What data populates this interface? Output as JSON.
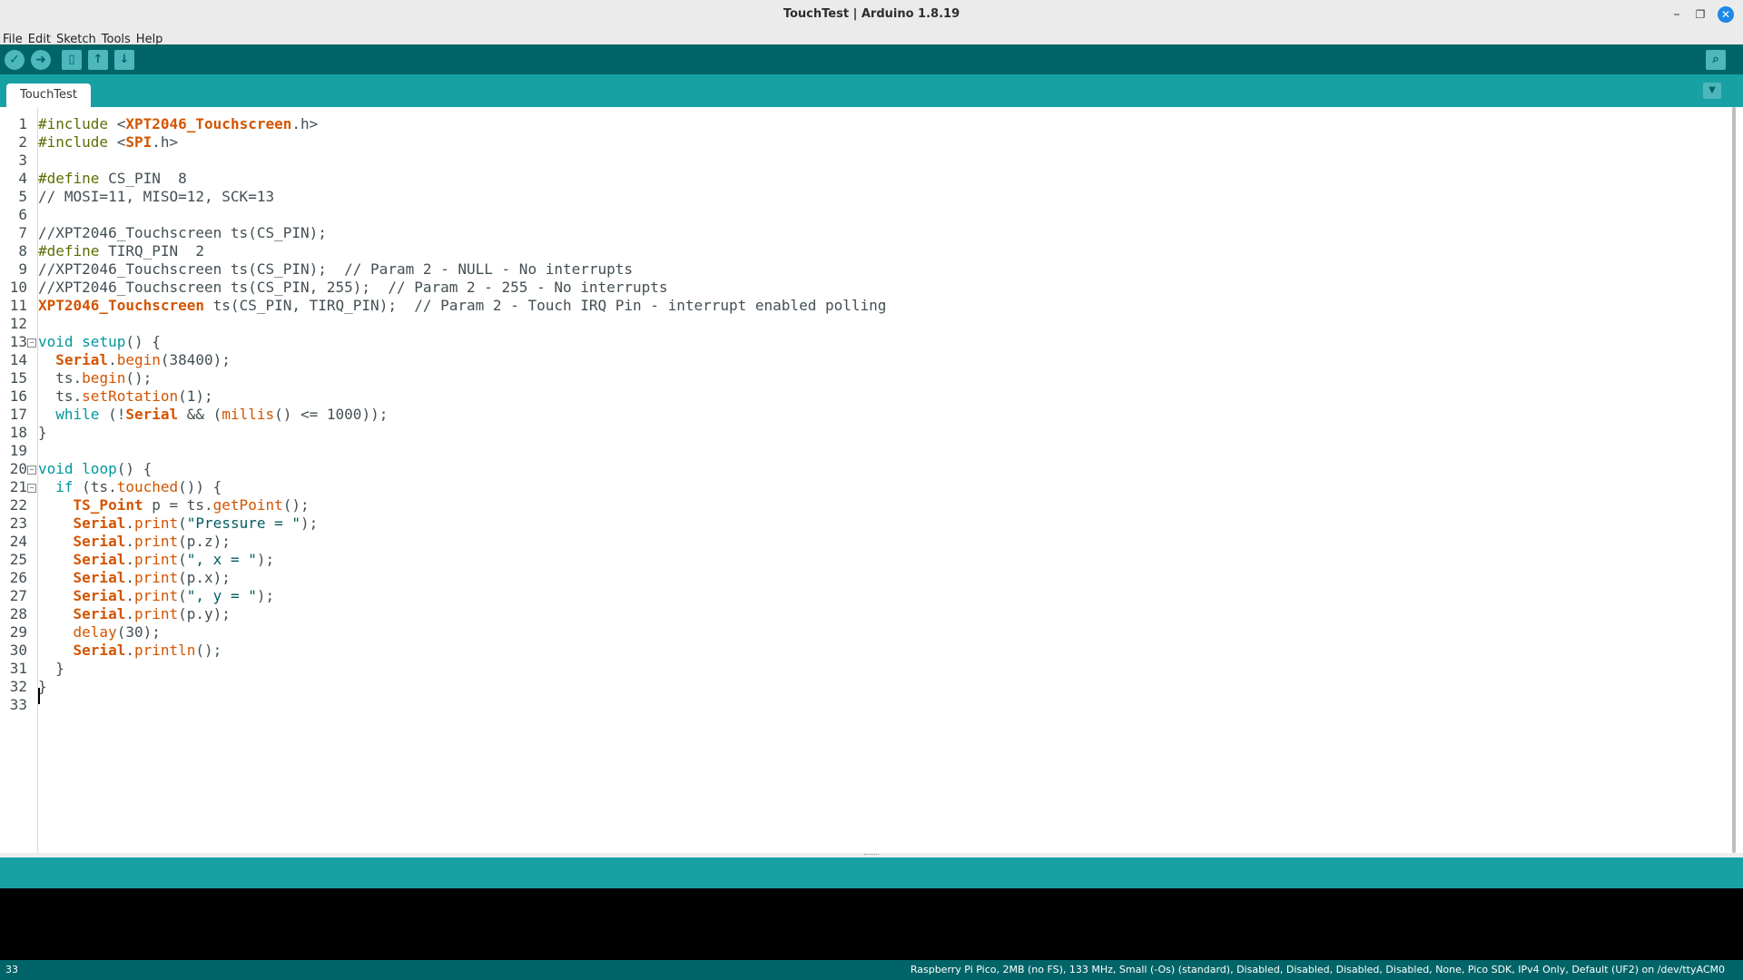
{
  "window": {
    "title": "TouchTest | Arduino 1.8.19",
    "minimize": "–",
    "maximize": "❐",
    "close": "✕"
  },
  "menu": [
    "File",
    "Edit",
    "Sketch",
    "Tools",
    "Help"
  ],
  "toolbar": {
    "verify": "✓",
    "upload": "➜",
    "new": "▯",
    "open": "↑",
    "save": "↓",
    "serial_monitor": "⌕"
  },
  "tabs": [
    {
      "label": "TouchTest",
      "active": true
    }
  ],
  "tab_menu_icon": "▼",
  "code_lines": [
    [
      [
        "inc",
        "#include "
      ],
      [
        "",
        "<"
      ],
      [
        "ty",
        "XPT2046_Touchscreen"
      ],
      [
        "",
        ".h>"
      ]
    ],
    [
      [
        "inc",
        "#include "
      ],
      [
        "",
        "<"
      ],
      [
        "ty",
        "SPI"
      ],
      [
        "",
        ".h>"
      ]
    ],
    [],
    [
      [
        "inc",
        "#define "
      ],
      [
        "",
        "CS_PIN  8"
      ]
    ],
    [
      [
        "cm",
        "// MOSI=11, MISO=12, SCK=13"
      ]
    ],
    [],
    [
      [
        "cm",
        "//XPT2046_Touchscreen ts(CS_PIN);"
      ]
    ],
    [
      [
        "inc",
        "#define "
      ],
      [
        "",
        "TIRQ_PIN  2"
      ]
    ],
    [
      [
        "cm",
        "//XPT2046_Touchscreen ts(CS_PIN);  // Param 2 - NULL - No interrupts"
      ]
    ],
    [
      [
        "cm",
        "//XPT2046_Touchscreen ts(CS_PIN, 255);  // Param 2 - 255 - No interrupts"
      ]
    ],
    [
      [
        "ty",
        "XPT2046_Touchscreen"
      ],
      [
        "",
        " ts(CS_PIN, TIRQ_PIN);  "
      ],
      [
        "cm",
        "// Param 2 - Touch IRQ Pin - interrupt enabled polling"
      ]
    ],
    [],
    [
      [
        "kw",
        "void"
      ],
      [
        "",
        " "
      ],
      [
        "kw",
        "setup"
      ],
      [
        "",
        "() {"
      ]
    ],
    [
      [
        "",
        "  "
      ],
      [
        "ty",
        "Serial"
      ],
      [
        "",
        "."
      ],
      [
        "fn",
        "begin"
      ],
      [
        "",
        "(38400);"
      ]
    ],
    [
      [
        "",
        "  ts."
      ],
      [
        "fn",
        "begin"
      ],
      [
        "",
        "();"
      ]
    ],
    [
      [
        "",
        "  ts."
      ],
      [
        "fn",
        "setRotation"
      ],
      [
        "",
        "(1);"
      ]
    ],
    [
      [
        "",
        "  "
      ],
      [
        "kw",
        "while"
      ],
      [
        "",
        " (!"
      ],
      [
        "ty",
        "Serial"
      ],
      [
        "",
        " && ("
      ],
      [
        "fn",
        "millis"
      ],
      [
        "",
        "() <= 1000));"
      ]
    ],
    [
      [
        "",
        "}"
      ]
    ],
    [],
    [
      [
        "kw",
        "void"
      ],
      [
        "",
        " "
      ],
      [
        "kw",
        "loop"
      ],
      [
        "",
        "() {"
      ]
    ],
    [
      [
        "",
        "  "
      ],
      [
        "kw",
        "if"
      ],
      [
        "",
        " (ts."
      ],
      [
        "fn",
        "touched"
      ],
      [
        "",
        "()) {"
      ]
    ],
    [
      [
        "",
        "    "
      ],
      [
        "ty",
        "TS_Point"
      ],
      [
        "",
        " p = ts."
      ],
      [
        "fn",
        "getPoint"
      ],
      [
        "",
        "();"
      ]
    ],
    [
      [
        "",
        "    "
      ],
      [
        "ty",
        "Serial"
      ],
      [
        "",
        "."
      ],
      [
        "fn",
        "print"
      ],
      [
        "",
        "("
      ],
      [
        "str",
        "\"Pressure = \""
      ],
      [
        "",
        ");"
      ]
    ],
    [
      [
        "",
        "    "
      ],
      [
        "ty",
        "Serial"
      ],
      [
        "",
        "."
      ],
      [
        "fn",
        "print"
      ],
      [
        "",
        "(p.z);"
      ]
    ],
    [
      [
        "",
        "    "
      ],
      [
        "ty",
        "Serial"
      ],
      [
        "",
        "."
      ],
      [
        "fn",
        "print"
      ],
      [
        "",
        "("
      ],
      [
        "str",
        "\", x = \""
      ],
      [
        "",
        ");"
      ]
    ],
    [
      [
        "",
        "    "
      ],
      [
        "ty",
        "Serial"
      ],
      [
        "",
        "."
      ],
      [
        "fn",
        "print"
      ],
      [
        "",
        "(p.x);"
      ]
    ],
    [
      [
        "",
        "    "
      ],
      [
        "ty",
        "Serial"
      ],
      [
        "",
        "."
      ],
      [
        "fn",
        "print"
      ],
      [
        "",
        "("
      ],
      [
        "str",
        "\", y = \""
      ],
      [
        "",
        ");"
      ]
    ],
    [
      [
        "",
        "    "
      ],
      [
        "ty",
        "Serial"
      ],
      [
        "",
        "."
      ],
      [
        "fn",
        "print"
      ],
      [
        "",
        "(p.y);"
      ]
    ],
    [
      [
        "",
        "    "
      ],
      [
        "fn",
        "delay"
      ],
      [
        "",
        "(30);"
      ]
    ],
    [
      [
        "",
        "    "
      ],
      [
        "ty",
        "Serial"
      ],
      [
        "",
        "."
      ],
      [
        "fn",
        "println"
      ],
      [
        "",
        "();"
      ]
    ],
    [
      [
        "",
        "  }"
      ]
    ],
    [
      [
        "",
        "}"
      ]
    ],
    []
  ],
  "fold_lines": [
    13,
    20,
    21
  ],
  "fold_glyph": "−",
  "status": {
    "line": "33",
    "board": "Raspberry Pi Pico, 2MB (no FS), 133 MHz, Small (-Os) (standard), Disabled, Disabled, Disabled, Disabled, None, Pico SDK, IPv4 Only, Default (UF2) on /dev/ttyACM0"
  },
  "colors": {
    "toolbar": "#006468",
    "tabbar": "#17a1a5",
    "keyword": "#00979c",
    "type": "#d35400",
    "console": "#000000"
  }
}
